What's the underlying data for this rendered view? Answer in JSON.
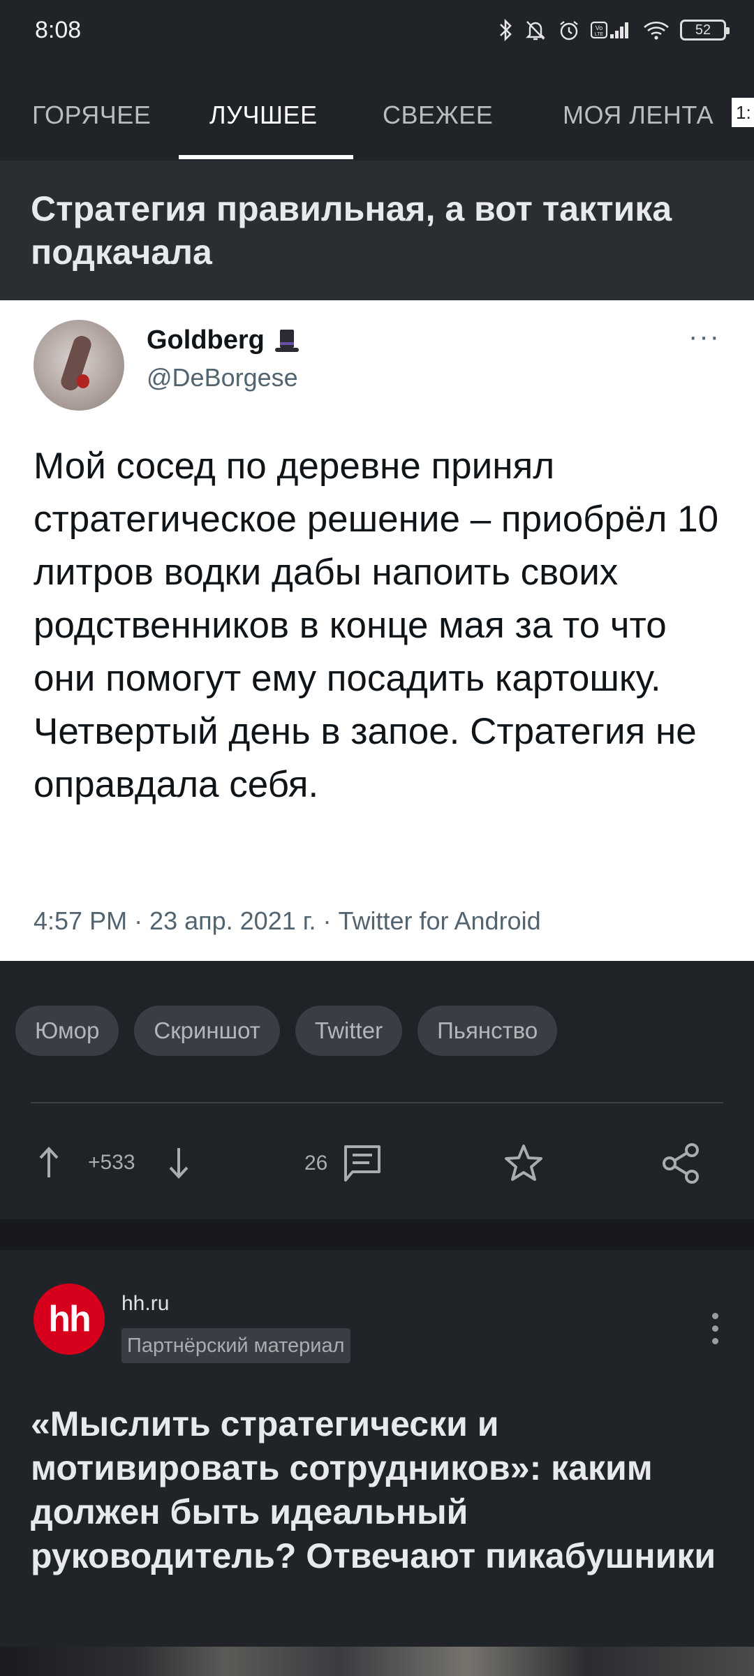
{
  "status_bar": {
    "time": "8:08",
    "battery": "52"
  },
  "tabs": [
    {
      "label": "ГОРЯЧЕЕ"
    },
    {
      "label": "ЛУЧШЕЕ",
      "active": true
    },
    {
      "label": "СВЕЖЕЕ"
    },
    {
      "label": "МОЯ ЛЕНТА"
    }
  ],
  "tab_badge": "1:",
  "post": {
    "title": "Стратегия правильная, а вот тактика подкачала",
    "tweet": {
      "name": "Goldberg",
      "handle": "@DeBorgese",
      "text": "Мой сосед по деревне принял стратегическое решение – приобрёл 10 литров водки дабы напоить своих родственников в конце мая за то что они помогут ему посадить картошку. Четвертый день в запое. Стратегия не оправдала себя.",
      "meta": "4:57 PM · 23 апр. 2021 г. · Twitter for Android"
    },
    "tags": [
      "Юмор",
      "Скриншот",
      "Twitter",
      "Пьянство"
    ],
    "rating": "+533",
    "comments": "26"
  },
  "partner": {
    "name": "hh.ru",
    "logo_text": "hh",
    "badge": "Партнёрский материал",
    "title": "«Мыслить стратегически и мотивировать сотрудников»: каким должен быть идеальный руководитель? Отвечают пикабушники"
  },
  "colors": {
    "background": "#1f2227",
    "card": "#2a2d32",
    "accent_brand": "#d6001c"
  }
}
